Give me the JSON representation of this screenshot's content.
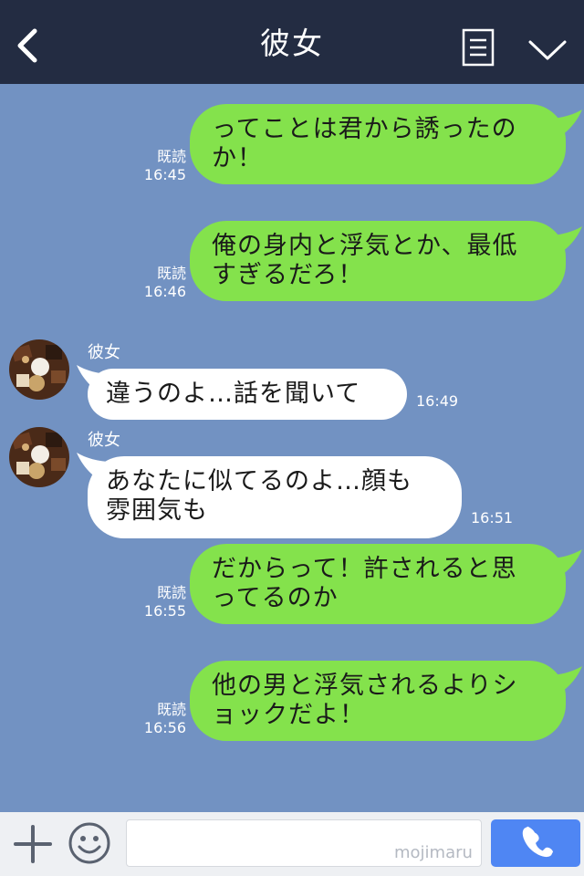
{
  "header": {
    "title": "彼女",
    "icons": [
      "back-arrow-icon",
      "memo-icon",
      "chevron-down-icon"
    ]
  },
  "messages": [
    {
      "from": "me",
      "text": "ってことは君から誘ったの\nか！",
      "read": "既読",
      "time": "16:45"
    },
    {
      "from": "me",
      "text": "俺の身内と浮気とか、最低\nすぎるだろ！",
      "read": "既読",
      "time": "16:46"
    },
    {
      "from": "them",
      "sender": "彼女",
      "text": "違うのよ…話を聞いて",
      "time": "16:49"
    },
    {
      "from": "them",
      "sender": "彼女",
      "text": "あなたに似てるのよ…顔も\n雰囲気も",
      "time": "16:51"
    },
    {
      "from": "me",
      "text": "だからって！許されると思\nってるのか",
      "read": "既読",
      "time": "16:55"
    },
    {
      "from": "me",
      "text": "他の男と浮気されるよりシ\nョックだよ！",
      "read": "既読",
      "time": "16:56"
    }
  ],
  "input": {
    "placeholder": "",
    "watermark": "mojimaru"
  },
  "colors": {
    "header": "#232c42",
    "chat_bg": "#7292c2",
    "my_bubble": "#84e24c",
    "their_bubble": "#ffffff",
    "call_button": "#4f86f3"
  }
}
